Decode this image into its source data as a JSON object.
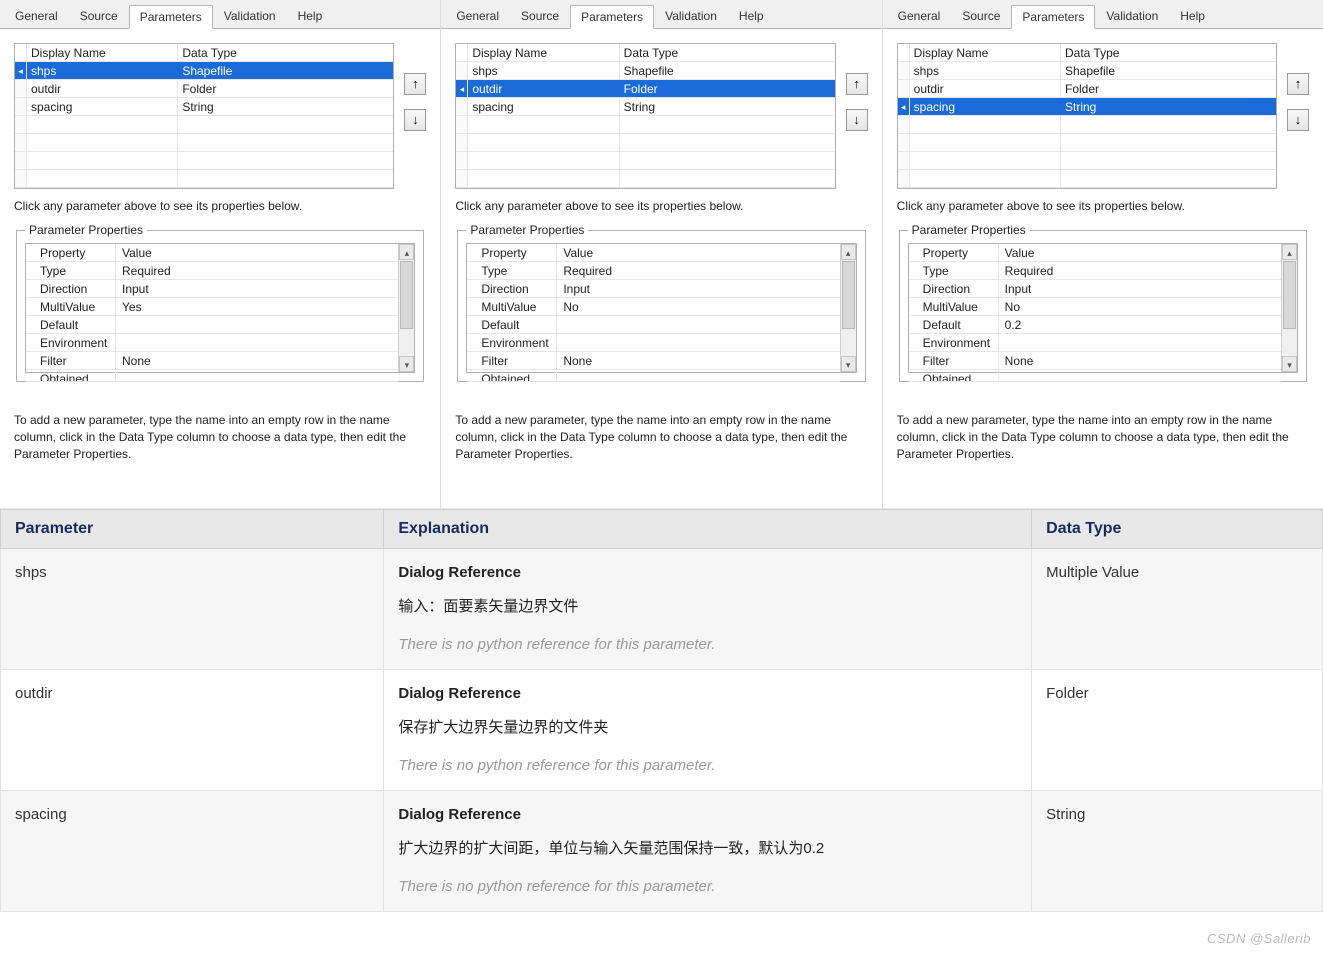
{
  "tabs": [
    "General",
    "Source",
    "Parameters",
    "Validation",
    "Help"
  ],
  "active_tab": "Parameters",
  "param_headers": {
    "name": "Display Name",
    "type": "Data Type"
  },
  "params": [
    {
      "name": "shps",
      "type": "Shapefile"
    },
    {
      "name": "outdir",
      "type": "Folder"
    },
    {
      "name": "spacing",
      "type": "String"
    }
  ],
  "hint": "Click any parameter above to see its properties below.",
  "props_legend": "Parameter Properties",
  "prop_headers": {
    "prop": "Property",
    "val": "Value"
  },
  "prop_labels": [
    "Type",
    "Direction",
    "MultiValue",
    "Default",
    "Environment",
    "Filter",
    "Obtained from"
  ],
  "panels": [
    {
      "selected": 0,
      "props": {
        "Type": "Required",
        "Direction": "Input",
        "MultiValue": "Yes",
        "Default": "",
        "Environment": "",
        "Filter": "None",
        "Obtained from": ""
      }
    },
    {
      "selected": 1,
      "props": {
        "Type": "Required",
        "Direction": "Input",
        "MultiValue": "No",
        "Default": "",
        "Environment": "",
        "Filter": "None",
        "Obtained from": ""
      }
    },
    {
      "selected": 2,
      "props": {
        "Type": "Required",
        "Direction": "Input",
        "MultiValue": "No",
        "Default": "0.2",
        "Environment": "",
        "Filter": "None",
        "Obtained from": ""
      }
    }
  ],
  "footnote": "To add a new parameter, type the name into an empty row in the name column, click in the Data Type column to choose a data type, then edit the Parameter Properties.",
  "doc": {
    "headers": {
      "param": "Parameter",
      "expl": "Explanation",
      "type": "Data Type"
    },
    "ref_title": "Dialog Reference",
    "ref_note": "There is no python reference for this parameter.",
    "rows": [
      {
        "param": "shps",
        "desc": "输入：面要素矢量边界文件",
        "type": "Multiple Value"
      },
      {
        "param": "outdir",
        "desc": "保存扩大边界矢量边界的文件夹",
        "type": "Folder"
      },
      {
        "param": "spacing",
        "desc": "扩大边界的扩大间距，单位与输入矢量范围保持一致，默认为0.2",
        "type": "String"
      }
    ]
  },
  "watermark": "CSDN @Sallerib"
}
